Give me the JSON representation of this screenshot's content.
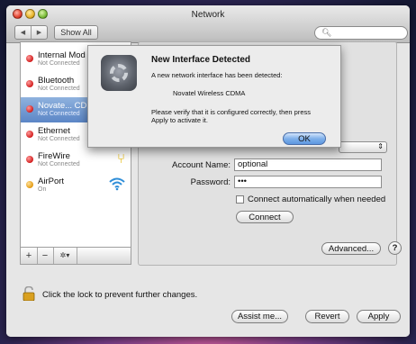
{
  "window": {
    "title": "Network",
    "show_all": "Show All",
    "nav_back": "◀",
    "nav_forward": "▶",
    "search_placeholder": ""
  },
  "services": [
    {
      "name": "Internal Mod",
      "status": "Not Connected",
      "dot": "red",
      "icon": "phone-icon",
      "selected": false
    },
    {
      "name": "Bluetooth",
      "status": "Not Connected",
      "dot": "red",
      "icon": "bluetooth-icon",
      "selected": false
    },
    {
      "name": "Novate... CD",
      "status": "Not Connected",
      "dot": "red",
      "icon": "modem-icon",
      "selected": true
    },
    {
      "name": "Ethernet",
      "status": "Not Connected",
      "dot": "red",
      "icon": "ethernet-arrows-icon",
      "selected": false
    },
    {
      "name": "FireWire",
      "status": "Not Connected",
      "dot": "red",
      "icon": "firewire-icon",
      "selected": false
    },
    {
      "name": "AirPort",
      "status": "On",
      "dot": "amber",
      "icon": "wifi-icon",
      "selected": false
    }
  ],
  "sidebar_toolbar": {
    "add": "+",
    "remove": "−",
    "action": "✲▾"
  },
  "config": {
    "account_label": "Account Name:",
    "account_value": "optional",
    "password_label": "Password:",
    "password_value": "•••",
    "auto_connect_label": "Connect automatically when needed",
    "connect_button": "Connect",
    "advanced_button": "Advanced...",
    "help_button": "?"
  },
  "dialog": {
    "title": "New Interface Detected",
    "message": "A new network interface has been detected:",
    "interface_name": "Novatel Wireless CDMA",
    "verify_text": "Please verify that it is configured correctly, then press Apply to activate it.",
    "ok_button": "OK"
  },
  "footer": {
    "lock_text": "Click the lock to prevent further changes.",
    "assist_button": "Assist me...",
    "revert_button": "Revert",
    "apply_button": "Apply"
  },
  "colors": {
    "status_red": "#d21c1c",
    "status_amber": "#e49a12",
    "selection": "#5b86c6"
  }
}
